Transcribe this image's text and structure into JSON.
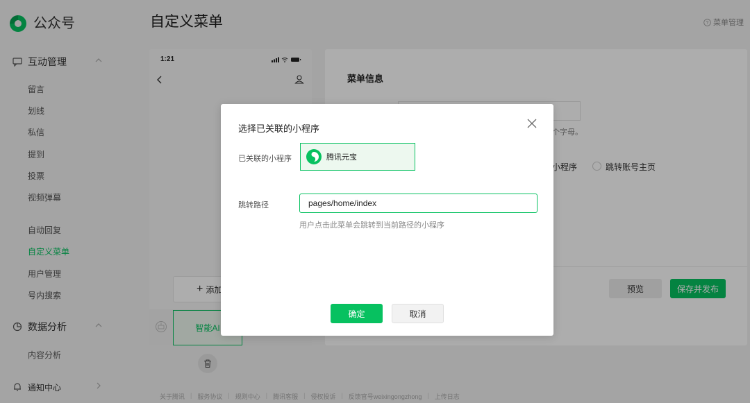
{
  "app": {
    "name": "公众号"
  },
  "page": {
    "title": "自定义菜单",
    "help_label": "菜单管理"
  },
  "sidebar": {
    "groups": [
      {
        "label": "互动管理",
        "items": [
          "留言",
          "划线",
          "私信",
          "提到",
          "投票",
          "视频弹幕"
        ]
      },
      {
        "items": [
          "自动回复",
          "自定义菜单",
          "用户管理",
          "号内搜索"
        ],
        "active": "自定义菜单"
      },
      {
        "label": "数据分析",
        "items": [
          "内容分析"
        ]
      },
      {
        "label": "通知中心"
      }
    ]
  },
  "phone": {
    "time": "1:21",
    "add_menu_label": "添加",
    "smart_menu_label": "智能AI"
  },
  "panel": {
    "title": "菜单信息",
    "hint_fragment": "个字母。",
    "option_fragment": "小程序",
    "option_profile": "跳转账号主页",
    "preview_label": "预览",
    "publish_label": "保存并发布"
  },
  "modal": {
    "title": "选择已关联的小程序",
    "linked_label": "已关联的小程序",
    "miniapp_name": "腾讯元宝",
    "path_label": "跳转路径",
    "path_value": "pages/home/index",
    "path_hint": "用户点击此菜单会跳转到当前路径的小程序",
    "confirm_label": "确定",
    "cancel_label": "取消"
  },
  "footer": {
    "links": [
      "关于腾讯",
      "服务协议",
      "规则中心",
      "腾讯客服",
      "侵权投诉",
      "反馈官号weixingongzhong",
      "上传日志"
    ]
  },
  "colors": {
    "accent": "#07c160",
    "accent_light": "#edf8ef"
  }
}
